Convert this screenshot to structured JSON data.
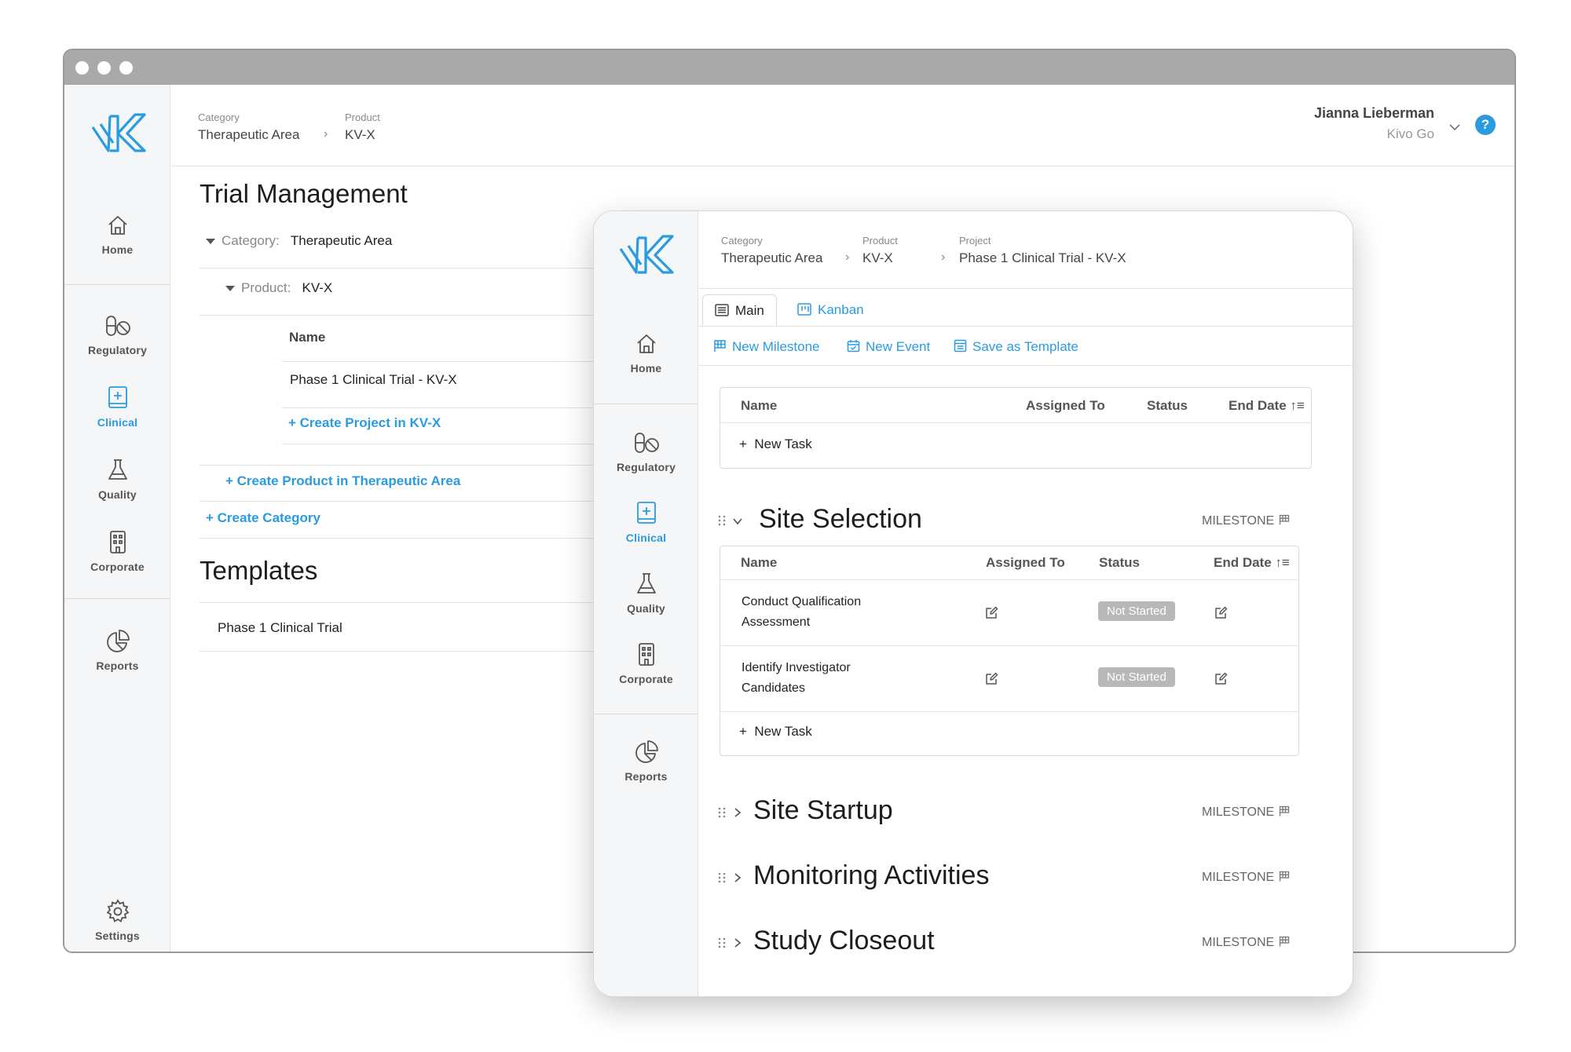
{
  "sidebar": {
    "items": [
      {
        "label": "Home",
        "icon": "home-icon"
      },
      {
        "label": "Regulatory",
        "icon": "pills-icon"
      },
      {
        "label": "Clinical",
        "icon": "clinical-icon"
      },
      {
        "label": "Quality",
        "icon": "flask-icon"
      },
      {
        "label": "Corporate",
        "icon": "building-icon"
      },
      {
        "label": "Reports",
        "icon": "pie-chart-icon"
      },
      {
        "label": "Settings",
        "icon": "gear-icon"
      }
    ],
    "active": "Clinical",
    "accent": "#2b9be0"
  },
  "header": {
    "breadcrumb": [
      {
        "label": "Category",
        "value": "Therapeutic Area"
      },
      {
        "label": "Product",
        "value": "KV-X"
      }
    ],
    "user_name": "Jianna Lieberman",
    "user_org": "Kivo Go",
    "help": "?"
  },
  "main": {
    "title": "Trial Management",
    "category_key": "Category:",
    "category_value": "Therapeutic Area",
    "product_key": "Product:",
    "product_value": "KV-X",
    "name_header": "Name",
    "project_name": "Phase 1 Clinical Trial - KV-X",
    "create_project": "+ Create Project in KV-X",
    "create_product": "+ Create Product in Therapeutic Area",
    "create_category": "+ Create Category",
    "templates_title": "Templates",
    "template_item": "Phase 1 Clinical Trial"
  },
  "project": {
    "breadcrumb": [
      {
        "label": "Category",
        "value": "Therapeutic Area"
      },
      {
        "label": "Product",
        "value": "KV-X"
      },
      {
        "label": "Project",
        "value": "Phase 1 Clinical Trial - KV-X"
      }
    ],
    "tabs": [
      {
        "label": "Main"
      },
      {
        "label": "Kanban"
      }
    ],
    "actions": [
      {
        "label": "New Milestone"
      },
      {
        "label": "New Event"
      },
      {
        "label": "Save as Template"
      }
    ],
    "columns": {
      "name": "Name",
      "assigned": "Assigned To",
      "status": "Status",
      "end_date": "End Date"
    },
    "new_task": "New Task",
    "milestone_tag": "MILESTONE",
    "milestones": [
      {
        "title": "Site Selection",
        "expanded": true,
        "tasks": [
          {
            "name_line1": "Conduct Qualification",
            "name_line2": "Assessment",
            "status": "Not Started"
          },
          {
            "name_line1": "Identify Investigator",
            "name_line2": "Candidates",
            "status": "Not Started"
          }
        ]
      },
      {
        "title": "Site Startup",
        "expanded": false
      },
      {
        "title": "Monitoring Activities",
        "expanded": false
      },
      {
        "title": "Study Closeout",
        "expanded": false
      }
    ]
  }
}
